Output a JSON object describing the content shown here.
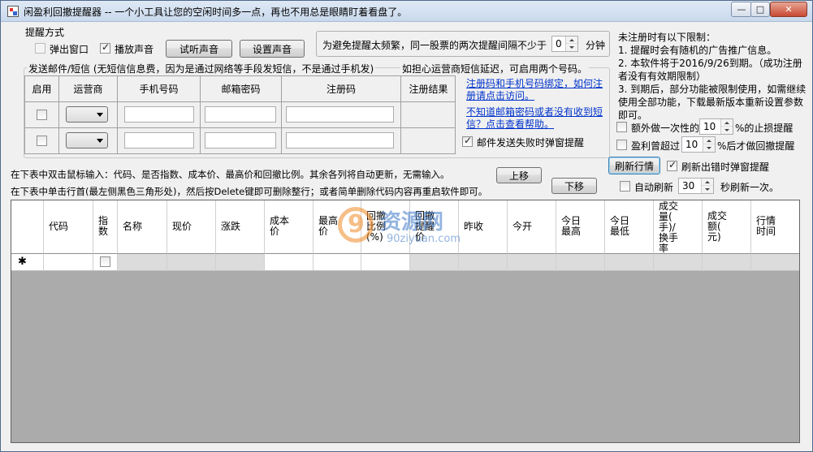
{
  "window": {
    "title": "闲盈利回撤提醒器 -- 一个小工具让您的空闲时间多一点，再也不用总是眼睛盯着看盘了。",
    "minimize": "—",
    "maximize": "□",
    "close": "✕"
  },
  "reminder": {
    "group_title": "提醒方式",
    "popup_label": "弹出窗口",
    "popup_checked": false,
    "sound_label": "播放声音",
    "sound_checked": true,
    "test_sound_button": "试听声音",
    "set_sound_button": "设置声音"
  },
  "interval": {
    "text": "为避免提醒太频繁，同一股票的两次提醒间隔不少于",
    "value": "0",
    "unit": "分钟"
  },
  "sms": {
    "group_title": "发送邮件/短信 (无短信信息费，因为是通过网络等手段发短信，不是通过手机发)",
    "delay_note": "如担心运营商短信延迟，可启用两个号码。",
    "columns": [
      "启用",
      "运营商",
      "手机号码",
      "邮箱密码",
      "注册码",
      "注册结果"
    ],
    "rows": 2,
    "link_bind": "注册码和手机号码绑定，如何注册请点击访问。",
    "link_help": "不知道邮箱密码或者没有收到短信？点击查看帮助。",
    "fail_popup_label": "邮件发送失败时弹窗提醒",
    "fail_popup_checked": true
  },
  "notice": {
    "title": "未注册时有以下限制：",
    "line1": "1. 提醒时会有随机的广告推广信息。",
    "line2": "2. 本软件将于2016/9/26到期。（成功注册者没有有效期限制）",
    "line3": "3. 到期后，部分功能被限制使用，如需继续使用全部功能，下载最新版本重新设置参数即可。"
  },
  "extra": {
    "stoploss_label": "额外做一次性的",
    "stoploss_value": "10",
    "stoploss_suffix": "%的止损提醒",
    "stoploss_checked": false,
    "profit_label": "盈利曾超过",
    "profit_value": "10",
    "profit_suffix": "%后才做回撤提醒",
    "profit_checked": false,
    "refresh_button": "刷新行情",
    "refresh_error_label": "刷新出错时弹窗提醒",
    "refresh_error_checked": true,
    "auto_refresh_label": "自动刷新",
    "auto_refresh_checked": false,
    "auto_refresh_value": "30",
    "auto_refresh_suffix": "秒刷新一次。"
  },
  "instructions": {
    "line1": "在下表中双击鼠标输入：代码、是否指数、成本价、最高价和回撤比例。其余各列将自动更新，无需输入。",
    "line2": "在下表中单击行首(最左侧黑色三角形处)，然后按Delete键即可删除整行；或者简单删除代码内容再重启软件即可。",
    "up_button": "上移",
    "down_button": "下移"
  },
  "grid": {
    "columns": [
      {
        "label": "代码"
      },
      {
        "label": "指\n数"
      },
      {
        "label": "名称"
      },
      {
        "label": "现价"
      },
      {
        "label": "涨跌"
      },
      {
        "label": "成本\n价"
      },
      {
        "label": "最高\n价"
      },
      {
        "label": "回撤\n比例\n(%)"
      },
      {
        "label": "回撤\n提醒\n价"
      },
      {
        "label": "昨收"
      },
      {
        "label": "今开"
      },
      {
        "label": "今日\n最高"
      },
      {
        "label": "今日\n最低"
      },
      {
        "label": "成交\n量(\n手)/\n换手\n率"
      },
      {
        "label": "成交\n额(\n元)"
      },
      {
        "label": "行情\n时间"
      }
    ],
    "new_row_marker": "✱"
  },
  "watermark": {
    "site_cn": "资源网",
    "site_url": "90ziyuan.com",
    "logo_digit": "9"
  },
  "colors": {
    "link": "#0033cc",
    "grid_background": "#ababab",
    "watermark_orange": "#f08c28",
    "watermark_blue": "#3c78c8"
  }
}
